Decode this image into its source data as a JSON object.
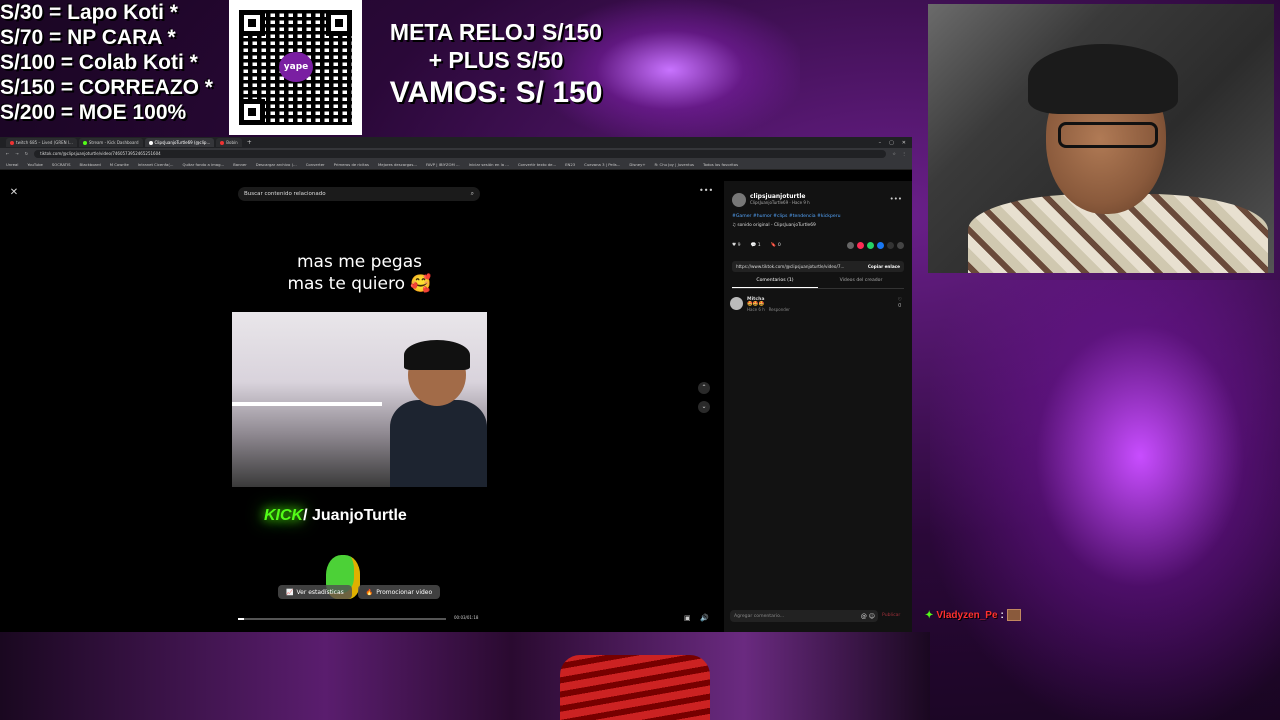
{
  "overlay": {
    "donations": [
      "S/30 = Lapo Koti *",
      "S/70 =  NP CARA *",
      "S/100 = Colab Koti *",
      "S/150 = CORREAZO *",
      "S/200 = MOE 100%"
    ],
    "qr_logo": "yape",
    "goal": {
      "line1": "META RELOJ S/150",
      "line2": "+ PLUS S/50",
      "line3": "VAMOS: S/ 150"
    }
  },
  "browser": {
    "tabs": [
      {
        "label": "twitch 685 – Lived (GREN l...",
        "color": "#e33"
      },
      {
        "label": "Stream - Kick Dashboard",
        "color": "#53fc18"
      },
      {
        "label": "ClipsJuanjoTurtle69 (@clip...",
        "color": "#fff",
        "active": true
      },
      {
        "label": "Bobín",
        "color": "#e33"
      }
    ],
    "new_tab": "+",
    "window_controls": [
      "–",
      "▢",
      "✕"
    ],
    "url": "tiktok.com/@clipsjuanjoturtle/video/7460573952465251604",
    "bookmarks": [
      "Unreal",
      "YouTube",
      "SOCRATIS",
      "Blackboard",
      "M Cowrite",
      "Intranet Cicenfa(...",
      "Quitar fondo a imag...",
      "Banner",
      "Descargar archivo (...",
      "Converter",
      "Primeros de ricitas",
      "Mejores descargas...",
      "FAVP | IBIYZOM ...",
      "Iniciar sesión en la ...",
      "Convertir texto de...",
      "EN23",
      "Cuevana 3 | Pelis...",
      "Disney+",
      "R: Chu Joy | Juventus",
      "Todos los favoritos"
    ]
  },
  "tiktok": {
    "search_placeholder": "Buscar contenido relacionado",
    "caption_line1": "mas me pegas",
    "caption_line2": "mas te quiero 🥰",
    "kick_logo": "KICK",
    "kick_channel": "/ JuanjoTurtle",
    "btn_stats": "Ver estadísticas",
    "btn_promote": "Promocionar video",
    "time": "00:03/01:18",
    "progress": 0.03,
    "author_name": "clipsjuanjoturtle",
    "author_meta": "ClipsJuanjoTurtle69 · Hace 9 h",
    "description": "#Gamer #humor #clips #tendencia #kickperu",
    "sound": "♫ sonido original - ClipsJuanjoTurtle69",
    "likes": "9",
    "comments": "1",
    "saves": "0",
    "link": "https://www.tiktok.com/@clipsjuanjoturtle/video/7...",
    "copy_link": "Copiar enlace",
    "tab_comments": "Comentarios (1)",
    "tab_creator": "Videos del creador",
    "comment_user": "Mitcha",
    "comment_text": "🤩🤩🤩",
    "comment_meta": "Hace 6 h",
    "comment_reply": "Responder",
    "comment_likes": "0",
    "comment_placeholder": "Agregar comentario...",
    "post_label": "Publicar"
  },
  "chat": {
    "username": "Vladyzen_Pe",
    "sep": ":"
  }
}
